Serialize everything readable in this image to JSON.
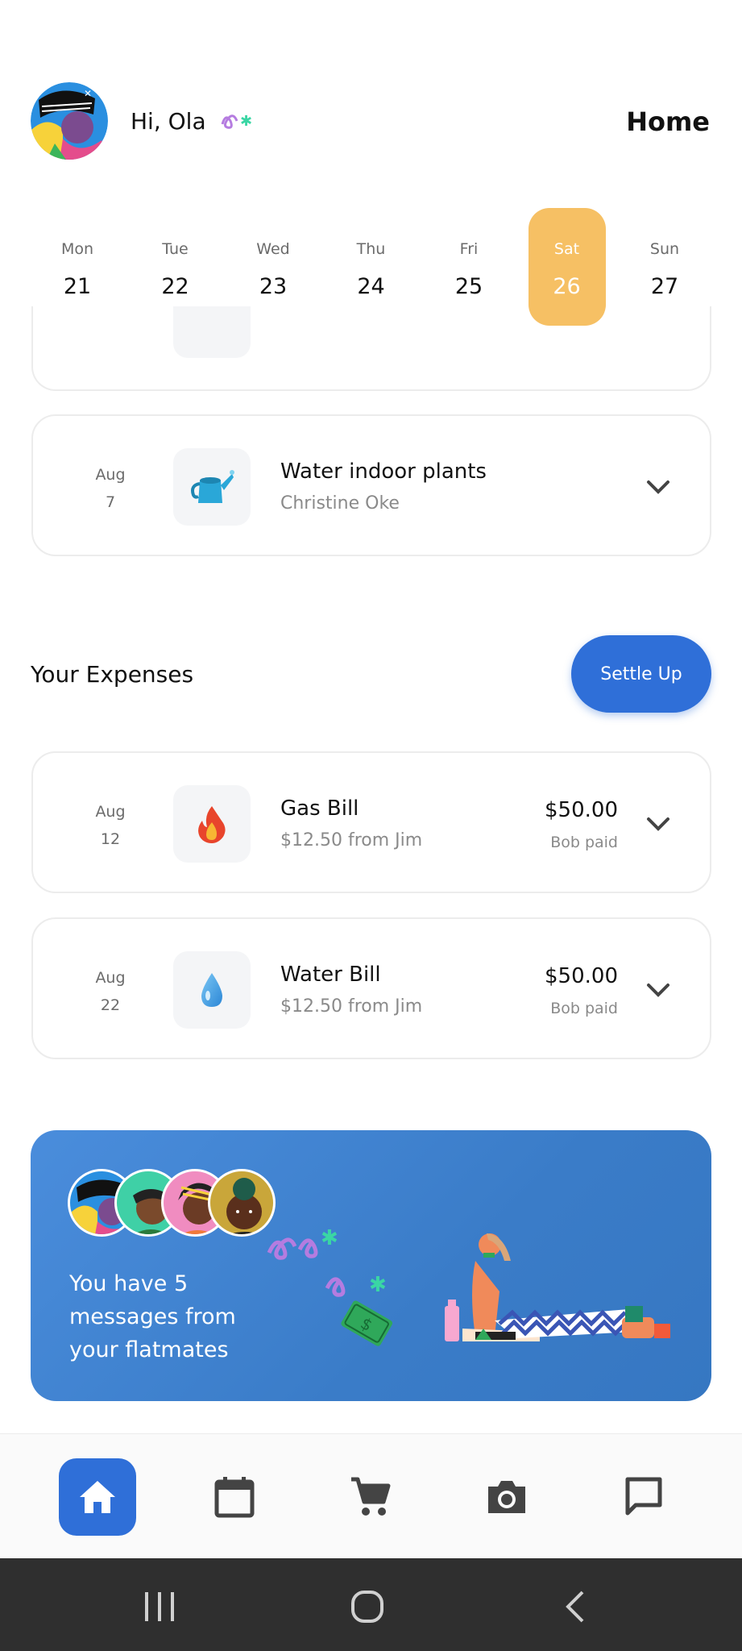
{
  "header": {
    "greeting": "Hi, Ola",
    "page_title": "Home"
  },
  "week": {
    "days": [
      {
        "name": "Mon",
        "num": "21"
      },
      {
        "name": "Tue",
        "num": "22"
      },
      {
        "name": "Wed",
        "num": "23"
      },
      {
        "name": "Thu",
        "num": "24"
      },
      {
        "name": "Fri",
        "num": "25"
      },
      {
        "name": "Sat",
        "num": "26"
      },
      {
        "name": "Sun",
        "num": "27"
      }
    ],
    "selected": "Sat"
  },
  "chores": [
    {
      "month": "Aug",
      "day": "7",
      "icon": "watering-can-icon",
      "title": "Water indoor plants",
      "person": "Christine Oke"
    }
  ],
  "expenses": {
    "section_title": "Your Expenses",
    "settle_label": "Settle Up",
    "items": [
      {
        "month": "Aug",
        "day": "12",
        "icon": "fire-icon",
        "title": "Gas Bill",
        "share": "$12.50 from Jim",
        "amount": "$50.00",
        "payer": "Bob paid"
      },
      {
        "month": "Aug",
        "day": "22",
        "icon": "water-drop-icon",
        "title": "Water Bill",
        "share": "$12.50 from Jim",
        "amount": "$50.00",
        "payer": "Bob paid"
      }
    ]
  },
  "banner": {
    "message": "You have 5 messages from your flatmates"
  },
  "nav": {
    "items": [
      "home-icon",
      "calendar-icon",
      "cart-icon",
      "camera-icon",
      "chat-icon"
    ],
    "active": "home-icon"
  },
  "colors": {
    "accent": "#2f6fd8",
    "selected_day": "#f6c064",
    "banner": "#3f82d0"
  }
}
